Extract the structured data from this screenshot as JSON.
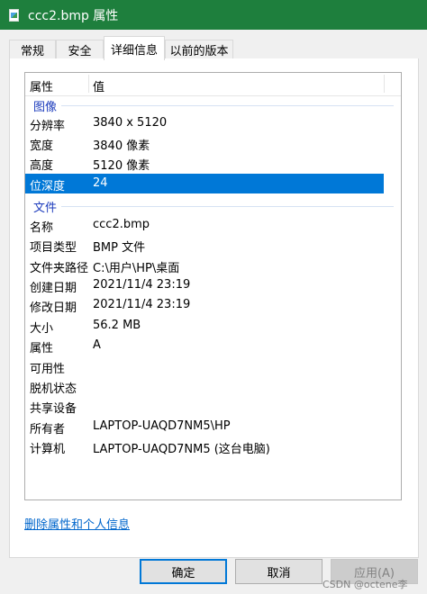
{
  "window": {
    "title": "ccc2.bmp 属性"
  },
  "tabs": [
    {
      "label": "常规",
      "active": false
    },
    {
      "label": "安全",
      "active": false
    },
    {
      "label": "详细信息",
      "active": true
    },
    {
      "label": "以前的版本",
      "active": false
    }
  ],
  "list": {
    "columns": {
      "property": "属性",
      "value": "值"
    },
    "groups": {
      "image": "图像",
      "file": "文件"
    },
    "image_rows": [
      {
        "name": "分辨率",
        "value": "3840 x 5120",
        "selected": false
      },
      {
        "name": "宽度",
        "value": "3840 像素",
        "selected": false
      },
      {
        "name": "高度",
        "value": "5120 像素",
        "selected": false
      },
      {
        "name": "位深度",
        "value": "24",
        "selected": true
      }
    ],
    "file_rows": [
      {
        "name": "名称",
        "value": "ccc2.bmp"
      },
      {
        "name": "项目类型",
        "value": "BMP 文件"
      },
      {
        "name": "文件夹路径",
        "value": "C:\\用户\\HP\\桌面"
      },
      {
        "name": "创建日期",
        "value": "2021/11/4 23:19"
      },
      {
        "name": "修改日期",
        "value": "2021/11/4 23:19"
      },
      {
        "name": "大小",
        "value": "56.2 MB"
      },
      {
        "name": "属性",
        "value": "A"
      },
      {
        "name": "可用性",
        "value": ""
      },
      {
        "name": "脱机状态",
        "value": ""
      },
      {
        "name": "共享设备",
        "value": ""
      },
      {
        "name": "所有者",
        "value": "LAPTOP-UAQD7NM5\\HP"
      },
      {
        "name": "计算机",
        "value": "LAPTOP-UAQD7NM5 (这台电脑)"
      }
    ]
  },
  "links": {
    "remove_properties": "删除属性和个人信息"
  },
  "buttons": {
    "ok": "确定",
    "cancel": "取消",
    "apply": "应用(A)"
  },
  "watermark": "CSDN @octene李",
  "colors": {
    "titlebar": "#1e7f3d",
    "selection": "#0078d7",
    "group_label": "#1e3dbd",
    "link": "#0066cc"
  }
}
